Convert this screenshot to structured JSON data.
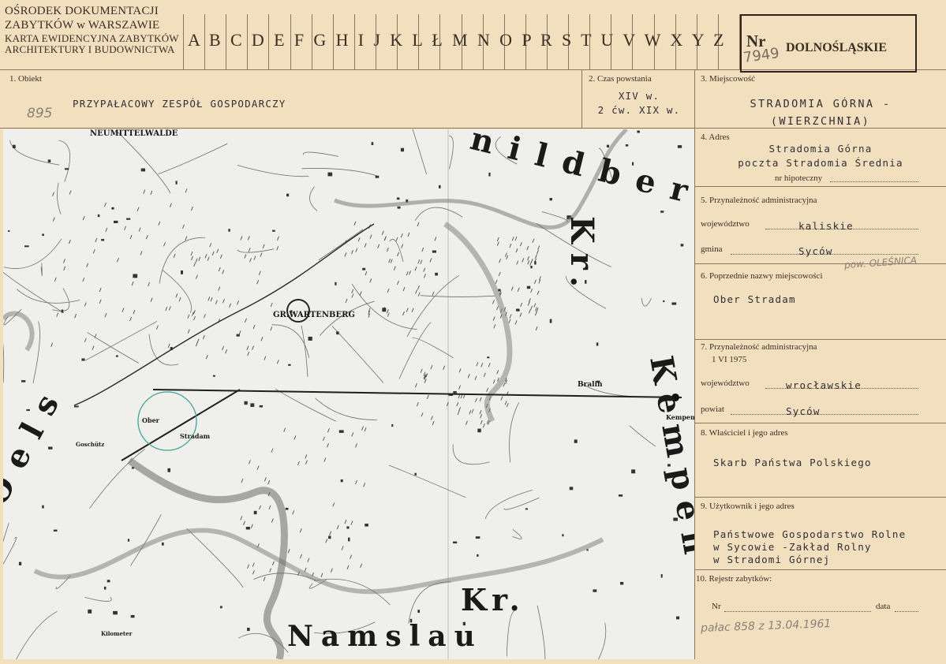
{
  "header": {
    "institution_lines": [
      "OŚRODEK DOKUMENTACJI",
      "ZABYTKÓW w WARSZAWIE",
      "KARTA EWIDENCYJNA ZABYTKÓW",
      "ARCHITEKTURY I BUDOWNICTWA"
    ],
    "letters": "A B C D E F G H I J K L Ł M N O P R S T U V W X Y Z",
    "nr_label": "Nr",
    "nr_value": "7949",
    "region": "DOLNOŚLĄSKIE"
  },
  "f1": {
    "label": "1. Obiekt",
    "value": "PRZYPAŁACOWY ZESPÓŁ GOSPODARCZY",
    "pencil": "895"
  },
  "f2": {
    "label": "2. Czas powstania",
    "line1": "XIV w.",
    "line2": "2 ćw. XIX w."
  },
  "f3": {
    "label": "3. Miejscowość",
    "line1": "STRADOMIA GÓRNA -",
    "line2": "(WIERZCHNIA)"
  },
  "f4": {
    "label": "4. Adres",
    "line1": "Stradomia Górna",
    "line2": "poczta Stradomia Średnia",
    "hip": "nr hipoteczny"
  },
  "f5": {
    "label": "5. Przynależność administracyjna",
    "woj_label": "województwo",
    "woj": "kaliskie",
    "gmina_label": "gmina",
    "gmina": "Syców",
    "pencil": "pow. OLEŚNICA"
  },
  "f6": {
    "label": "6. Poprzednie nazwy miejscowości",
    "value": "Ober Stradam"
  },
  "f7": {
    "label": "7. Przynależność administracyjna",
    "date": "1 VI 1975",
    "woj_label": "województwo",
    "woj": "wrocławskie",
    "pow_label": "powiat",
    "pow": "Syców"
  },
  "f8": {
    "label": "8. Właściciel i jego adres",
    "value": "Skarb Państwa Polskiego"
  },
  "f9": {
    "label": "9. Użytkownik i jego adres",
    "line1": "Państwowe Gospodarstwo Rolne",
    "line2": "w Sycowie -Zakład Rolny",
    "line3": "w Stradomi Górnej"
  },
  "f10": {
    "label": "10. Rejestr zabytków:",
    "nr_label": "Nr",
    "data_label": "data",
    "pencil": "pałac 858 z 13.04.1961"
  },
  "map": {
    "big_labels": [
      "nildberg",
      "Kr.",
      "Kempen",
      "Oels",
      "Kr.",
      "Namslau"
    ],
    "town_labels": [
      "NEUMITTELWALDE",
      "GR.WARTENBERG",
      "Bralin",
      "Kempen",
      "Ober",
      "Stradam",
      "Goschütz",
      "Kilometer"
    ]
  },
  "colors": {
    "card": "#f2dfbe",
    "ink": "#3a2f24",
    "map_bg": "#eeeeea",
    "circle": "#3aa79a"
  }
}
